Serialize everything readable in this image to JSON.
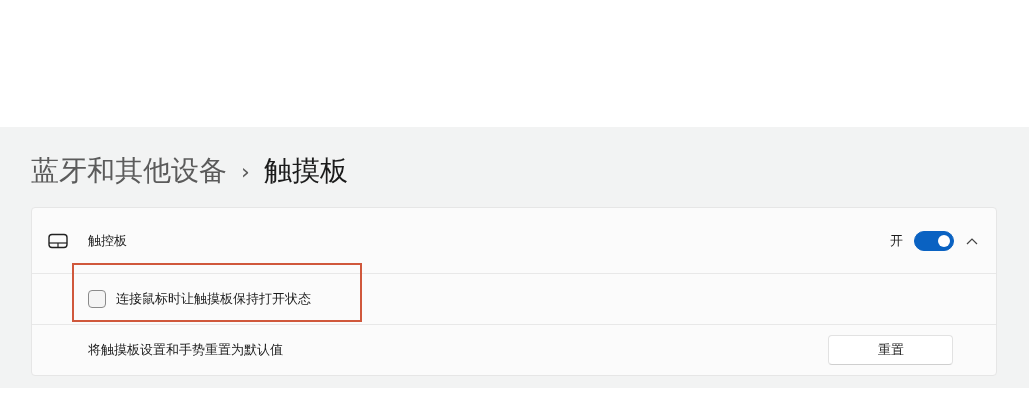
{
  "breadcrumb": {
    "parent": "蓝牙和其他设备",
    "separator": "›",
    "current": "触摸板"
  },
  "card": {
    "header": {
      "label": "触控板",
      "state_label": "开",
      "on": true,
      "expanded": true
    },
    "rows": [
      {
        "kind": "checkbox",
        "label": "连接鼠标时让触摸板保持打开状态",
        "checked": false,
        "highlighted": true
      },
      {
        "kind": "button",
        "label": "将触摸板设置和手势重置为默认值",
        "button": "重置"
      }
    ]
  }
}
